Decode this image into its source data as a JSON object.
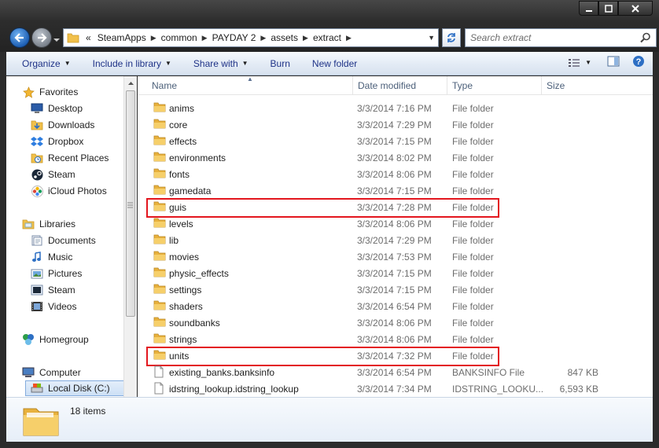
{
  "window": {
    "caption_buttons": [
      "minimize",
      "maximize",
      "close"
    ]
  },
  "address_bar": {
    "overflow": "«",
    "breadcrumbs": [
      "SteamApps",
      "common",
      "PAYDAY 2",
      "assets",
      "extract"
    ]
  },
  "search": {
    "placeholder": "Search extract"
  },
  "toolbar": {
    "organize": "Organize",
    "include_in_library": "Include in library",
    "share_with": "Share with",
    "burn": "Burn",
    "new_folder": "New folder"
  },
  "nav_pane": {
    "favorites": {
      "label": "Favorites",
      "items": [
        "Desktop",
        "Downloads",
        "Dropbox",
        "Recent Places",
        "Steam",
        "iCloud Photos"
      ]
    },
    "libraries": {
      "label": "Libraries",
      "items": [
        "Documents",
        "Music",
        "Pictures",
        "Steam",
        "Videos"
      ]
    },
    "homegroup": "Homegroup",
    "computer": {
      "label": "Computer",
      "items": [
        "Local Disk (C:)"
      ]
    }
  },
  "columns": {
    "name": "Name",
    "date_modified": "Date modified",
    "type": "Type",
    "size": "Size"
  },
  "files": [
    {
      "name": "anims",
      "date": "3/3/2014 7:16 PM",
      "type": "File folder",
      "size": "",
      "kind": "folder"
    },
    {
      "name": "core",
      "date": "3/3/2014 7:29 PM",
      "type": "File folder",
      "size": "",
      "kind": "folder"
    },
    {
      "name": "effects",
      "date": "3/3/2014 7:15 PM",
      "type": "File folder",
      "size": "",
      "kind": "folder"
    },
    {
      "name": "environments",
      "date": "3/3/2014 8:02 PM",
      "type": "File folder",
      "size": "",
      "kind": "folder"
    },
    {
      "name": "fonts",
      "date": "3/3/2014 8:06 PM",
      "type": "File folder",
      "size": "",
      "kind": "folder"
    },
    {
      "name": "gamedata",
      "date": "3/3/2014 7:15 PM",
      "type": "File folder",
      "size": "",
      "kind": "folder"
    },
    {
      "name": "guis",
      "date": "3/3/2014 7:28 PM",
      "type": "File folder",
      "size": "",
      "kind": "folder",
      "highlighted": true
    },
    {
      "name": "levels",
      "date": "3/3/2014 8:06 PM",
      "type": "File folder",
      "size": "",
      "kind": "folder"
    },
    {
      "name": "lib",
      "date": "3/3/2014 7:29 PM",
      "type": "File folder",
      "size": "",
      "kind": "folder"
    },
    {
      "name": "movies",
      "date": "3/3/2014 7:53 PM",
      "type": "File folder",
      "size": "",
      "kind": "folder"
    },
    {
      "name": "physic_effects",
      "date": "3/3/2014 7:15 PM",
      "type": "File folder",
      "size": "",
      "kind": "folder"
    },
    {
      "name": "settings",
      "date": "3/3/2014 7:15 PM",
      "type": "File folder",
      "size": "",
      "kind": "folder"
    },
    {
      "name": "shaders",
      "date": "3/3/2014 6:54 PM",
      "type": "File folder",
      "size": "",
      "kind": "folder"
    },
    {
      "name": "soundbanks",
      "date": "3/3/2014 8:06 PM",
      "type": "File folder",
      "size": "",
      "kind": "folder"
    },
    {
      "name": "strings",
      "date": "3/3/2014 8:06 PM",
      "type": "File folder",
      "size": "",
      "kind": "folder"
    },
    {
      "name": "units",
      "date": "3/3/2014 7:32 PM",
      "type": "File folder",
      "size": "",
      "kind": "folder",
      "highlighted": true
    },
    {
      "name": "existing_banks.banksinfo",
      "date": "3/3/2014 6:54 PM",
      "type": "BANKSINFO File",
      "size": "847 KB",
      "kind": "file"
    },
    {
      "name": "idstring_lookup.idstring_lookup",
      "date": "3/3/2014 7:34 PM",
      "type": "IDSTRING_LOOKU...",
      "size": "6,593 KB",
      "kind": "file"
    }
  ],
  "status": {
    "item_count": "18 items"
  },
  "colors": {
    "highlight_box": "#e3161e",
    "link_text": "#1e3287",
    "folder_yellow": "#f1c04a"
  }
}
